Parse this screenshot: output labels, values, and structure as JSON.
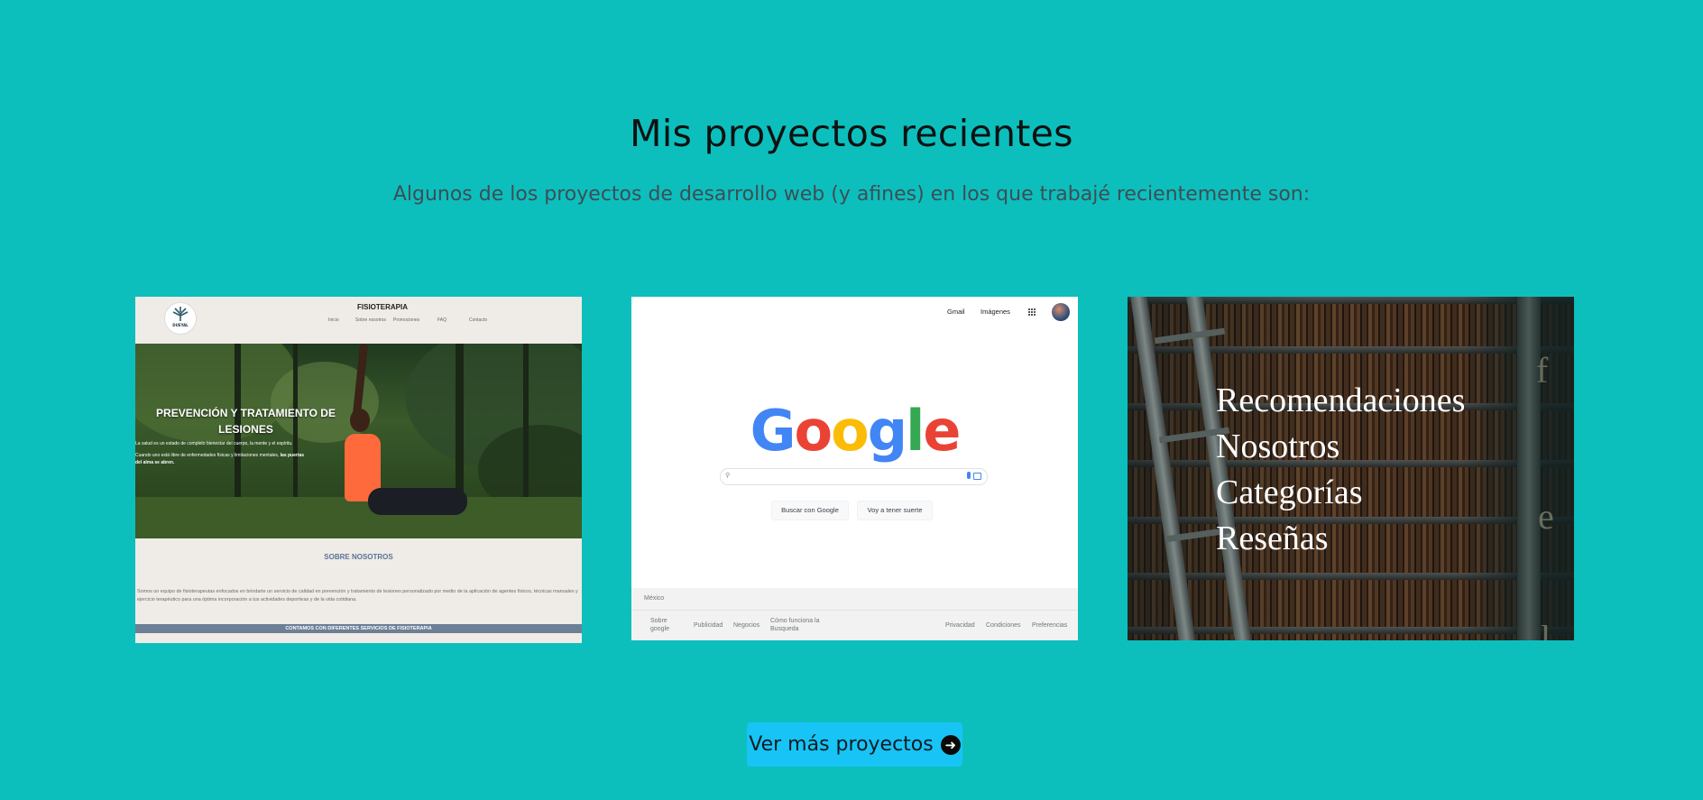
{
  "section": {
    "title": "Mis proyectos recientes",
    "subtitle": "Algunos de los proyectos de desarrollo web (y afines) en los que trabajé recientemente son:"
  },
  "projects": [
    {
      "header": {
        "brand": "FISIOTERAPIA",
        "logo_text": "DUEYAL",
        "nav": [
          "Inicio",
          "Sobre nosotros",
          "Promociones",
          "FAQ",
          "Contacto"
        ]
      },
      "hero": {
        "title": "PREVENCIÓN Y TRATAMIENTO DE LESIONES",
        "line1": "La salud es un estado de completo bienestar del cuerpo, la mente y el espíritu.",
        "line2a": "Cuando uno está libre de enfermedades físicas y limitaciones mentales,",
        "line2b": "las puertas",
        "line3": "del alma se abren."
      },
      "about": {
        "heading": "SOBRE NOSOTROS",
        "body": "Somos un equipo de fisioterapeutas enfocados en brindarte un servicio de calidad en prevención y tratamiento de lesiones personalizado por medio de la aplicación de agentes físicos, técnicas manuales y ejercicio terapéutico para una óptima incorporación a tus actividades deportivas y de la vida cotidiana."
      },
      "band": "CONTAMOS CON DIFERENTES SERVICIOS DE FISIOTERAPIA"
    },
    {
      "top_links": [
        "Gmail",
        "Imágenes"
      ],
      "logo_letters": [
        {
          "ch": "G",
          "color": "#4285f4"
        },
        {
          "ch": "o",
          "color": "#ea4335"
        },
        {
          "ch": "o",
          "color": "#fbbc05"
        },
        {
          "ch": "g",
          "color": "#4285f4"
        },
        {
          "ch": "l",
          "color": "#34a853"
        },
        {
          "ch": "e",
          "color": "#ea4335"
        }
      ],
      "buttons": [
        "Buscar con Google",
        "Voy a tener suerte"
      ],
      "country": "México",
      "footer_left": [
        "Sobre google",
        "Publicidad",
        "Negocios",
        "Cómo funciona la Busqueda"
      ],
      "footer_right": [
        "Privacidad",
        "Condiciones",
        "Preferencias"
      ]
    },
    {
      "menu": [
        "Recomendaciones",
        "Nosotros",
        "Categorías",
        "Reseñas"
      ],
      "side_letters": [
        "f",
        "e",
        "l"
      ]
    }
  ],
  "cta": {
    "label": "Ver más proyectos",
    "icon": "arrow-right-circle-icon"
  }
}
